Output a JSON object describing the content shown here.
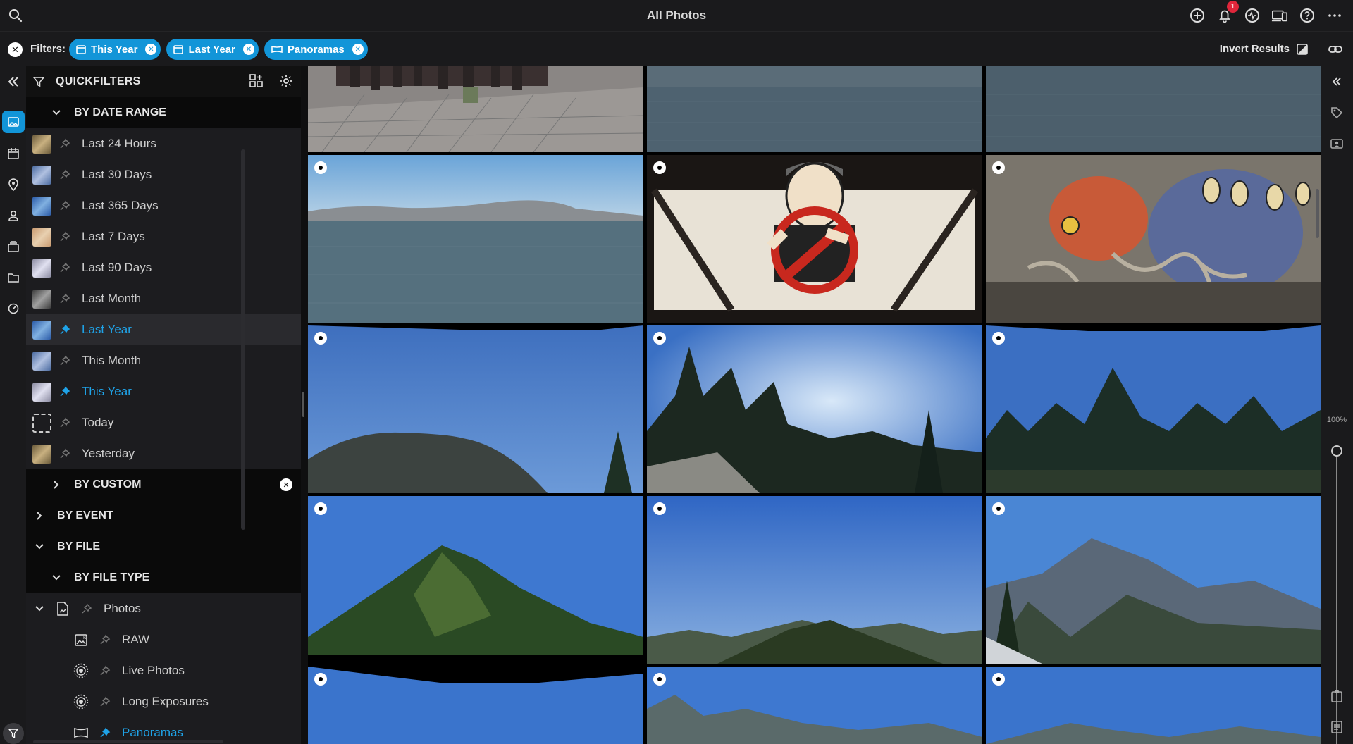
{
  "header": {
    "title": "All Photos",
    "notification_count": "1"
  },
  "filterbar": {
    "label": "Filters:",
    "chips": [
      {
        "label": "This Year",
        "icon": "calendar-icon"
      },
      {
        "label": "Last Year",
        "icon": "calendar-icon"
      },
      {
        "label": "Panoramas",
        "icon": "panorama-icon"
      }
    ],
    "invert_label": "Invert Results"
  },
  "sidebar": {
    "title": "QUICKFILTERS",
    "by_date_range": "BY DATE RANGE",
    "date_items": [
      {
        "label": "Last 24 Hours",
        "active": false
      },
      {
        "label": "Last 30 Days",
        "active": false
      },
      {
        "label": "Last 365 Days",
        "active": false
      },
      {
        "label": "Last 7 Days",
        "active": false
      },
      {
        "label": "Last 90 Days",
        "active": false
      },
      {
        "label": "Last Month",
        "active": false
      },
      {
        "label": "Last Year",
        "active": true
      },
      {
        "label": "This Month",
        "active": false
      },
      {
        "label": "This Year",
        "active": true
      },
      {
        "label": "Today",
        "active": false
      },
      {
        "label": "Yesterday",
        "active": false
      }
    ],
    "by_custom": "BY CUSTOM",
    "by_event": "BY EVENT",
    "by_file": "BY FILE",
    "by_file_type": "BY FILE TYPE",
    "photos": "Photos",
    "file_items": [
      {
        "label": "RAW"
      },
      {
        "label": "Live Photos"
      },
      {
        "label": "Long Exposures"
      },
      {
        "label": "Panoramas"
      }
    ]
  },
  "zoom_level": "100%",
  "colors": {
    "accent": "#1295d8",
    "badge": "#e0263b"
  }
}
